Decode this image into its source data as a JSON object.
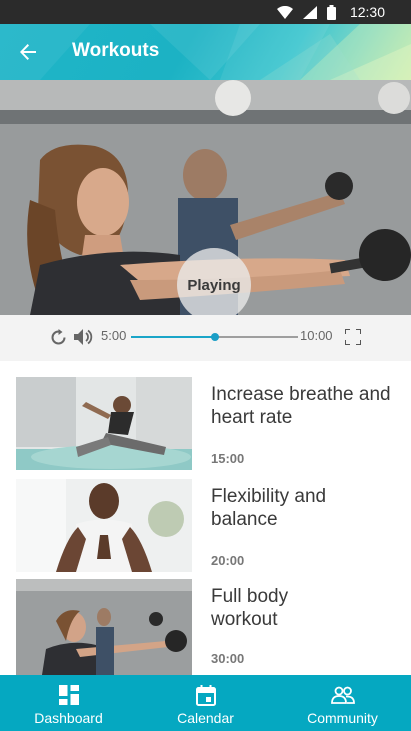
{
  "status_bar": {
    "time": "12:30",
    "icons": [
      "wifi-icon",
      "signal-icon",
      "battery-icon"
    ]
  },
  "app_bar": {
    "title": "Workouts",
    "back_icon": "arrow-back-icon"
  },
  "player": {
    "state_label": "Playing",
    "elapsed": "5:00",
    "total": "10:00",
    "progress": 0.5,
    "icons": [
      "replay-icon",
      "volume-icon",
      "fullscreen-icon"
    ]
  },
  "workouts": [
    {
      "title": "Increase breathe and heart rate",
      "duration": "15:00"
    },
    {
      "title": "Flexibility and balance",
      "duration": "20:00"
    },
    {
      "title": "Full body workout",
      "duration": "30:00"
    }
  ],
  "bottom_nav": [
    {
      "label": "Dashboard",
      "icon": "dashboard-icon"
    },
    {
      "label": "Calendar",
      "icon": "calendar-icon"
    },
    {
      "label": "Community",
      "icon": "community-icon"
    }
  ],
  "colors": {
    "accent": "#05a8c1",
    "progress": "#1aa5c8",
    "status_bar": "#2b2b2b"
  }
}
